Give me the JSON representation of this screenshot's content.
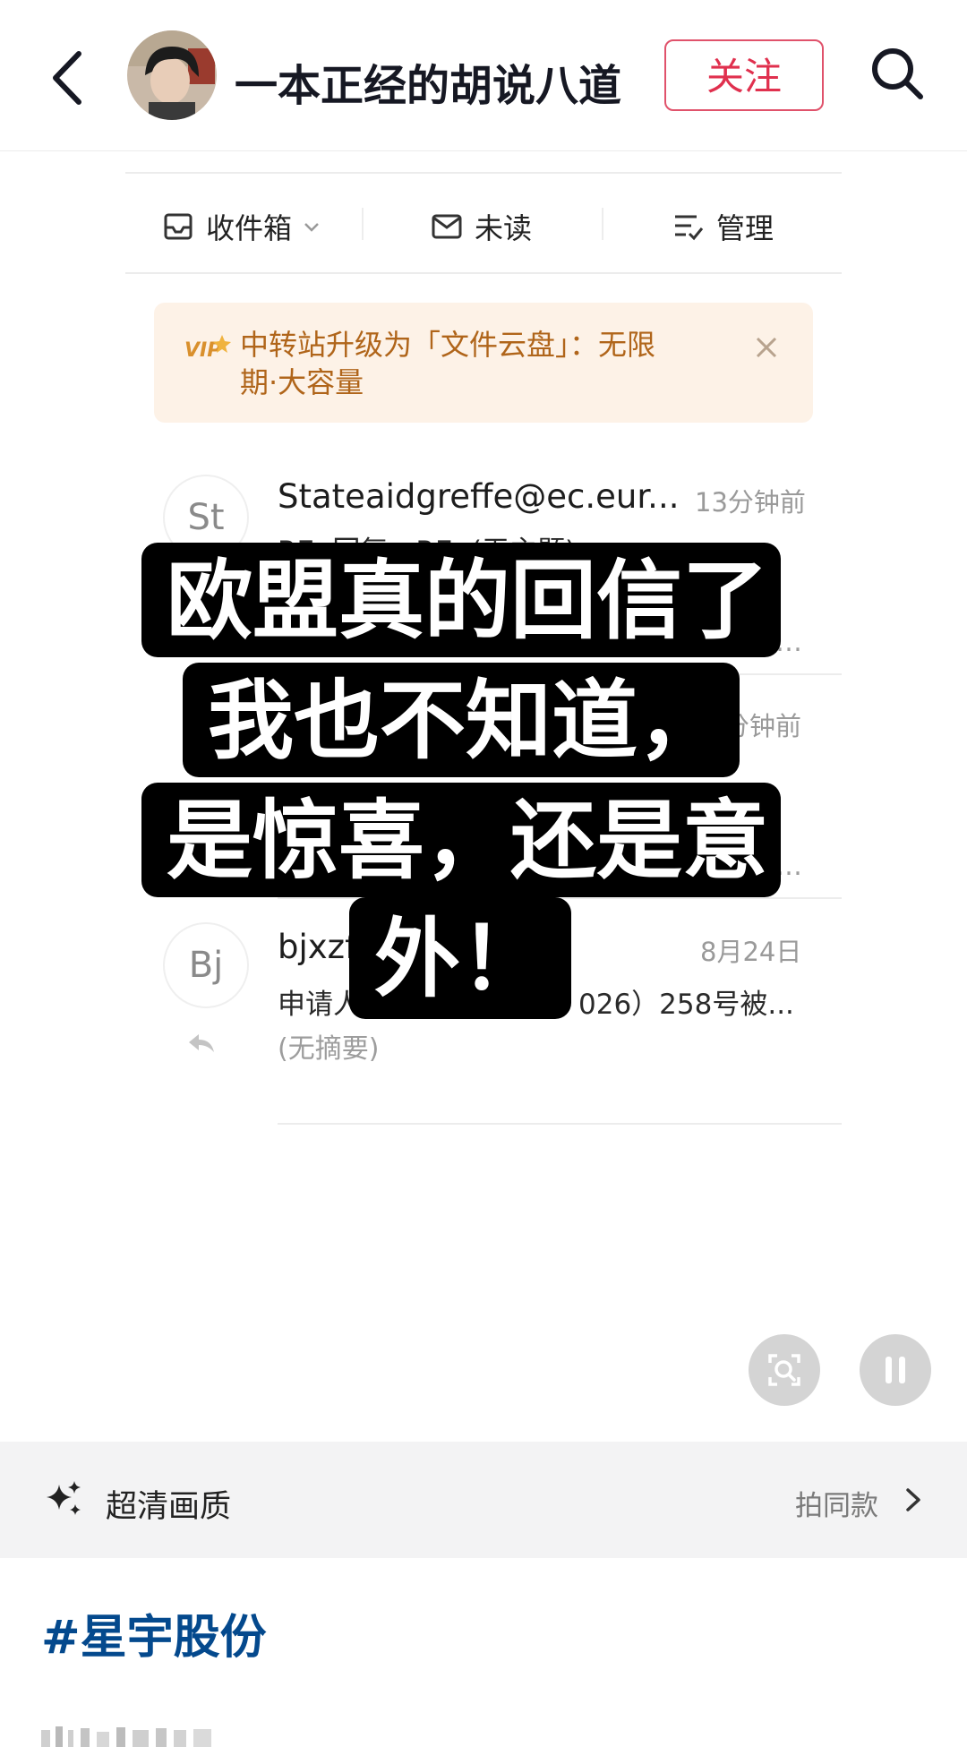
{
  "header": {
    "author_name": "一本正经的胡说八道",
    "follow_label": "关注"
  },
  "mail_tabs": {
    "inbox_label": "收件箱",
    "unread_label": "未读",
    "manage_label": "管理"
  },
  "banner": {
    "line1": "中转站升级为「文件云盘」：无限",
    "line2": "期·大容量",
    "vip_label": "VIP"
  },
  "emails": [
    {
      "avatar": "St",
      "sender": "Stateaidgreffe@ec.eur...",
      "time": "13分钟前",
      "subject_partial": "RE: 回复：RE: (无主题)"
    },
    {
      "time_partial": "分钟前"
    },
    {
      "avatar": "Bj",
      "sender_partial": "bjxzf",
      "time": "8月24日",
      "subject_left": "申请人",
      "subject_right": "026）258号被...",
      "summary": "(无摘要)"
    }
  ],
  "caption": {
    "line1": "欧盟真的回信了",
    "line2": "我也不知道，",
    "line3": "是惊喜，还是意",
    "line4": "外！"
  },
  "quality_bar": {
    "label": "超清画质",
    "right_label": "拍同款"
  },
  "hashtag": "#星宇股份",
  "colors": {
    "follow": "#e0304e",
    "hashtag": "#04498d",
    "banner_bg": "#fdf2e7",
    "banner_text": "#b0651a"
  }
}
